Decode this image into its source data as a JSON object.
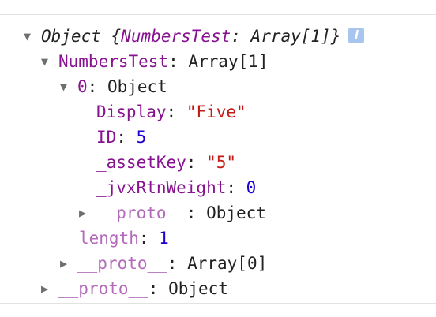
{
  "tree": {
    "root": {
      "label": "Object",
      "summary_open": "{",
      "summary_key": "NumbersTest",
      "summary_sep": ": ",
      "summary_value": "Array[1]",
      "summary_close": "}",
      "info_icon": "i"
    },
    "numbers_test": {
      "key": "NumbersTest",
      "sep": ": ",
      "value": "Array[1]"
    },
    "item_0": {
      "key": "0",
      "sep": ": ",
      "value": "Object"
    },
    "display": {
      "key": "Display",
      "sep": ": ",
      "value": "\"Five\""
    },
    "id": {
      "key": "ID",
      "sep": ": ",
      "value": "5"
    },
    "asset_key": {
      "key": "_assetKey",
      "sep": ": ",
      "value": "\"5\""
    },
    "rtn_weight": {
      "key": "_jvxRtnWeight",
      "sep": ": ",
      "value": "0"
    },
    "item_proto": {
      "key": "__proto__",
      "sep": ": ",
      "value": "Object"
    },
    "length": {
      "key": "length",
      "sep": ": ",
      "value": "1"
    },
    "array_proto": {
      "key": "__proto__",
      "sep": ": ",
      "value": "Array[0]"
    },
    "root_proto": {
      "key": "__proto__",
      "sep": ": ",
      "value": "Object"
    }
  },
  "icons": {
    "expanded": "▼",
    "collapsed": "▶"
  }
}
